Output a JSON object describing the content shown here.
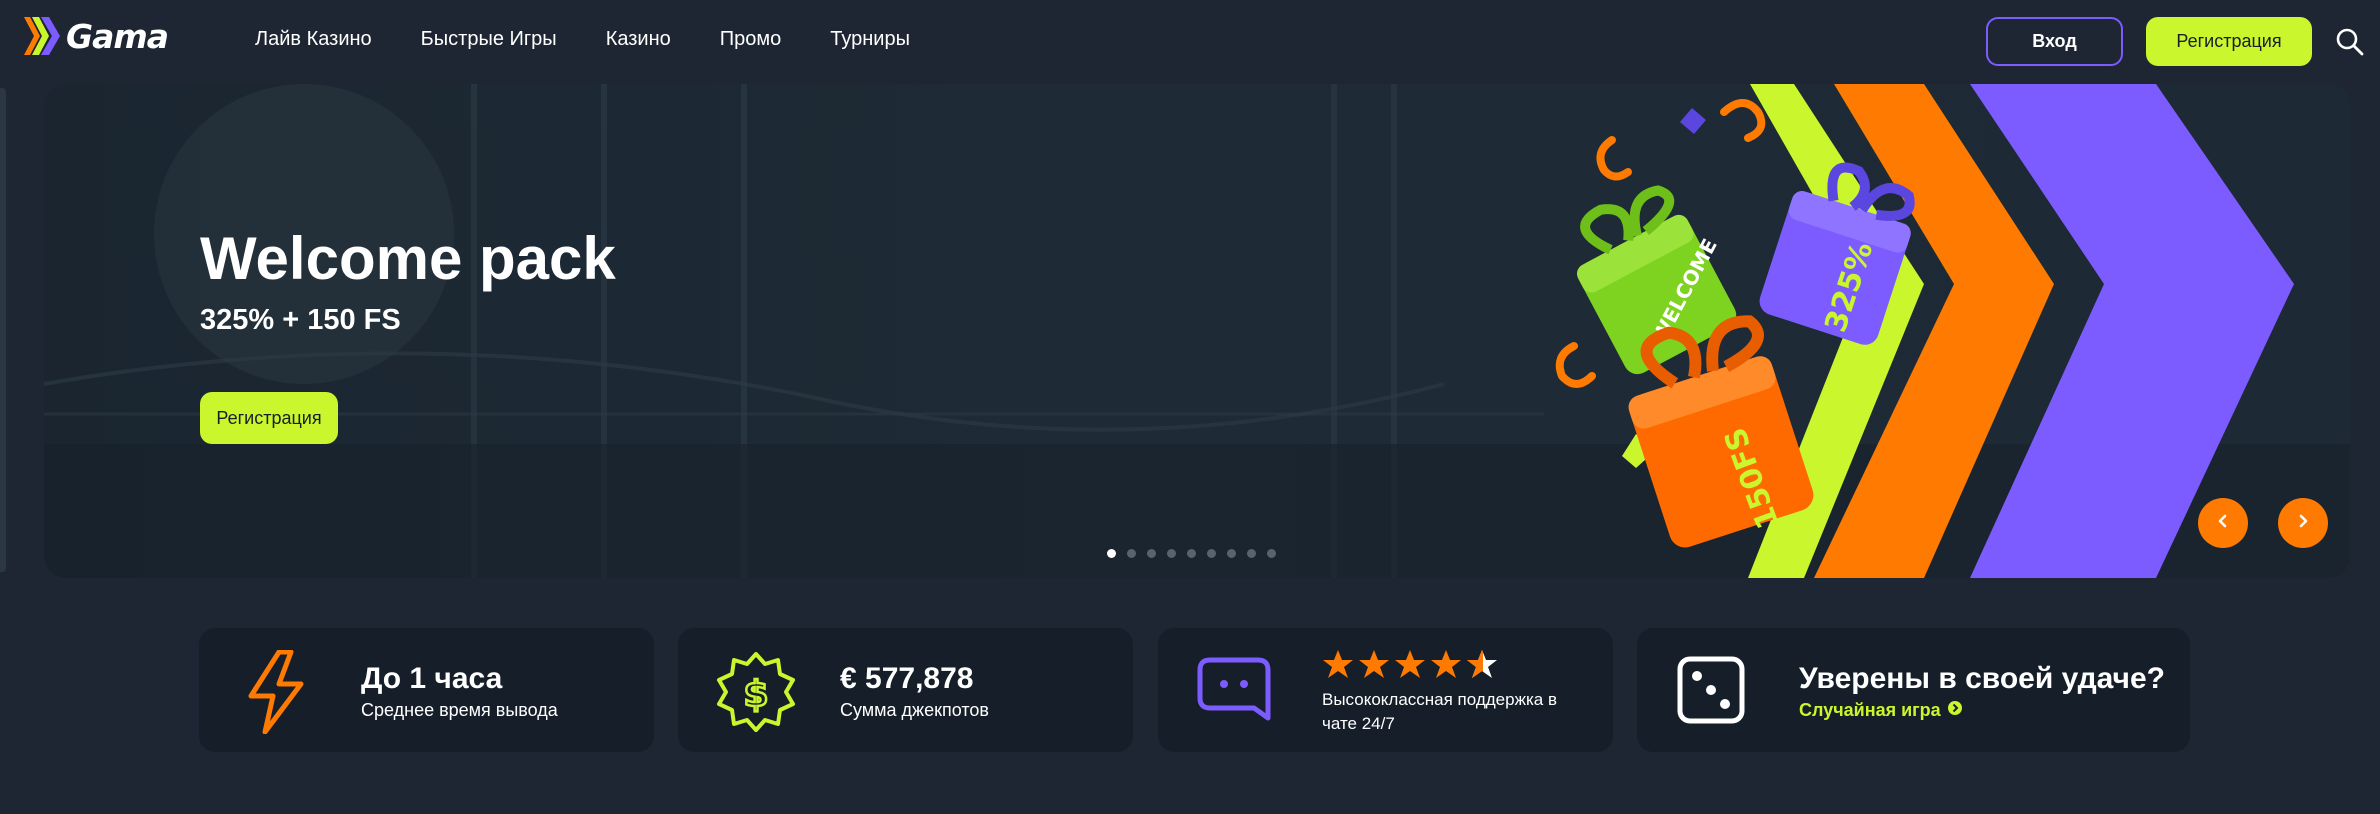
{
  "brand": {
    "name": "Gama"
  },
  "nav": [
    "Лайв Казино",
    "Быстрые Игры",
    "Казино",
    "Промо",
    "Турниры"
  ],
  "auth": {
    "login": "Вход",
    "register": "Регистрация"
  },
  "banner": {
    "title": "Welcome pack",
    "subtitle": "325% + 150 FS",
    "cta": "Регистрация",
    "art_labels": [
      "WELCOME",
      "325%",
      "150FS"
    ],
    "slides_total": 9,
    "active_slide": 1
  },
  "features": {
    "payout": {
      "title": "До 1 часа",
      "subtitle": "Среднее время вывода"
    },
    "jackpot": {
      "title": "€ 577,878",
      "subtitle": "Сумма джекпотов"
    },
    "support": {
      "line1": "Высококлассная поддержка в",
      "line2": "чате 24/7",
      "rating": 4.5,
      "rating_max": 5
    },
    "luck": {
      "title": "Уверены в своей удаче?",
      "link": "Случайная игра"
    }
  },
  "colors": {
    "accent_lime": "#c9f62d",
    "accent_orange": "#ff7a00",
    "accent_purple": "#7c5cff",
    "background": "#1d2632",
    "card": "#161f29"
  },
  "icons": [
    "logo-chevrons-icon",
    "search-icon",
    "chevron-left-icon",
    "chevron-right-icon",
    "lightning-icon",
    "dollar-badge-icon",
    "chat-bubble-icon",
    "star-icon",
    "dice-icon",
    "arrow-circle-right-icon"
  ]
}
